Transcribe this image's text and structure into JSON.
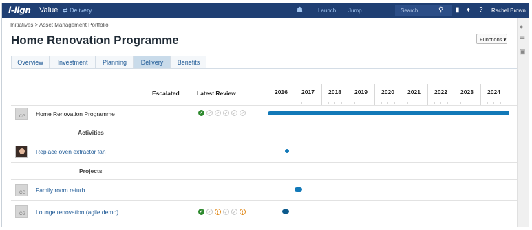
{
  "topbar": {
    "logo": "i-lign",
    "section": "Value",
    "switch_label": "⇄ Delivery",
    "home_icon": "home-icon",
    "launch": "Launch",
    "jump": "Jump",
    "search_placeholder": "Search",
    "user": "Rachel Brown"
  },
  "breadcrumb": "Initiatives > Asset Management Portfolio",
  "page_title": "Home Renovation Programme",
  "functions_button": "Functions ▾",
  "tabs": [
    {
      "label": "Overview",
      "active": false
    },
    {
      "label": "Investment",
      "active": false
    },
    {
      "label": "Planning",
      "active": false
    },
    {
      "label": "Delivery",
      "active": true
    },
    {
      "label": "Benefits",
      "active": false
    }
  ],
  "table": {
    "col_escalated": "Escalated",
    "col_latest_review": "Latest Review",
    "years": [
      "2016",
      "2017",
      "2018",
      "2019",
      "2020",
      "2021",
      "2022",
      "2023",
      "2024"
    ],
    "sections": {
      "activities": "Activities",
      "projects": "Projects"
    },
    "rows": [
      {
        "name": "Home Renovation Programme",
        "avatar": "CG",
        "review": [
          "ok",
          "none",
          "none",
          "none",
          "none",
          "none"
        ],
        "timeline": "full-bar"
      },
      {
        "name": "Replace oven extractor fan",
        "avatar": "photo",
        "review": [],
        "timeline": "dot"
      },
      {
        "name": "Family room refurb",
        "avatar": "CG",
        "review": [],
        "timeline": "short-bar"
      },
      {
        "name": "Lounge renovation (agile demo)",
        "avatar": "CG",
        "review": [
          "ok",
          "none",
          "warn",
          "none",
          "none",
          "warn"
        ],
        "timeline": "short-bar"
      }
    ]
  },
  "colors": {
    "topbar": "#1f3f73",
    "accent": "#1279b8",
    "ok": "#2f8a2f",
    "warn": "#e08a1b"
  }
}
